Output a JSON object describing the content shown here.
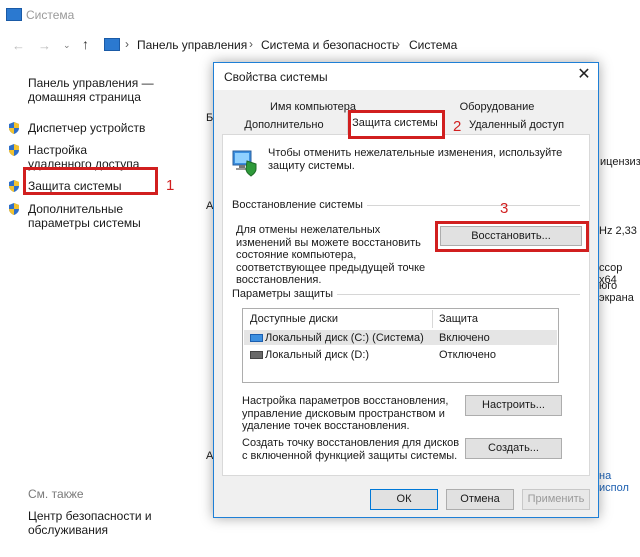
{
  "window": {
    "title": "Система"
  },
  "nav": {
    "back": "←",
    "forward": "→",
    "up": "↑",
    "separator": "›",
    "breadcrumb": [
      "Панель управления",
      "Система и безопасность",
      "Система"
    ]
  },
  "sidebar": {
    "home": "Панель управления — домашняя страница",
    "items": [
      {
        "label": "Диспетчер устройств"
      },
      {
        "label": "Настройка удаленного доступа"
      },
      {
        "label": "Защита системы"
      },
      {
        "label": "Дополнительные параметры системы"
      }
    ],
    "see_also": "См. также",
    "security_center": "Центр безопасности и обслуживания"
  },
  "background_fragments": {
    "a": "Б",
    "b": "ицензиз",
    "c": "Hz  2,33",
    "d": "ссор x64",
    "e": "юго экрана",
    "f": "на испол",
    "g": "A",
    "h": "A"
  },
  "annotations": {
    "n1": "1",
    "n2": "2",
    "n3": "3",
    "color": "#d11f1f"
  },
  "dialog": {
    "title": "Свойства системы",
    "close": "✕",
    "tabs_row1": [
      "Имя компьютера",
      "Оборудование"
    ],
    "tabs_row2": [
      "Дополнительно",
      "Защита системы",
      "Удаленный доступ"
    ],
    "intro": "Чтобы отменить нежелательные изменения, используйте защиту системы.",
    "restore_group": "Восстановление системы",
    "restore_text": "Для отмены нежелательных изменений вы можете восстановить состояние компьютера, соответствующее предыдущей точке восстановления.",
    "restore_button": "Восстановить...",
    "protection_group": "Параметры защиты",
    "columns": [
      "Доступные диски",
      "Защита"
    ],
    "disks": [
      {
        "name": "Локальный диск (C:) (Система)",
        "status": "Включено"
      },
      {
        "name": "Локальный диск (D:)",
        "status": "Отключено"
      }
    ],
    "configure_text": "Настройка параметров восстановления, управление дисковым пространством и удаление точек восстановления.",
    "configure_button": "Настроить...",
    "create_text": "Создать точку восстановления для дисков с включенной функцией защиты системы.",
    "create_button": "Создать...",
    "ok": "ОК",
    "cancel": "Отмена",
    "apply": "Применить"
  }
}
